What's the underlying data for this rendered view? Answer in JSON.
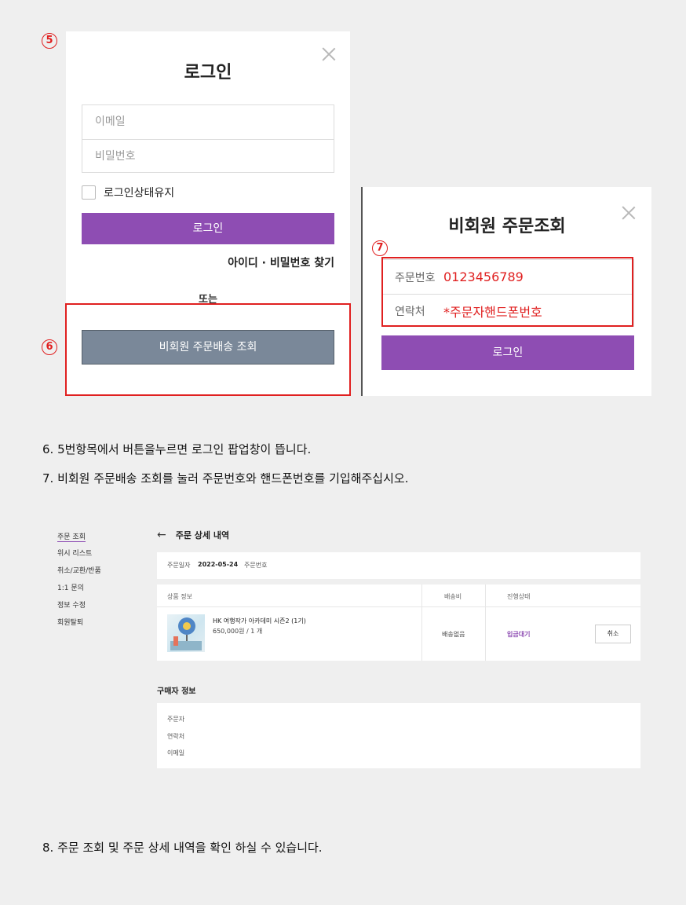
{
  "markers": {
    "five": "5",
    "six": "6",
    "seven": "7"
  },
  "login_popup": {
    "title": "로그인",
    "email_placeholder": "이메일",
    "password_placeholder": "비밀번호",
    "keep_login": "로그인상태유지",
    "login_button": "로그인",
    "find_link": "아이디 · 비밀번호 찾기",
    "or": "또는",
    "guest_button": "비회원 주문배송 조회"
  },
  "guest_popup": {
    "title": "비회원 주문조회",
    "order_no_label": "주문번호",
    "order_no_value": "0123456789",
    "contact_label": "연락처",
    "contact_value": "*주문자핸드폰번호",
    "login_button": "로그인"
  },
  "instructions": [
    "6. 5번항목에서 버튼을누르면  로그인 팝업창이 뜹니다.",
    "7. 비회원 주문배송 조회를 눌러 주문번호와 핸드폰번호를 기입해주십시오.",
    "8. 주문 조회 및 주문 상세 내역을 확인 하실 수 있습니다."
  ],
  "side_menu": [
    "주문 조회",
    "위시 리스트",
    "취소/교환/반품",
    "1:1 문의",
    "정보 수정",
    "회원탈퇴"
  ],
  "order_detail": {
    "back_icon": "arrow-left-icon",
    "title": "주문 상세 내역",
    "order_date_label": "주문일자",
    "order_date": "2022-05-24",
    "order_no_label": "주문번호",
    "columns": [
      "상품 정보",
      "배송비",
      "진행상태"
    ],
    "product": {
      "name": "HK 여행작가 아카데미 시즌2 (1기)",
      "price_qty": "650,000원 / 1 개",
      "shipping": "배송없음",
      "status": "입금대기",
      "cancel": "취소"
    },
    "buyer_title": "구매자 정보",
    "buyer_fields": [
      "주문자",
      "연락처",
      "이메일"
    ]
  },
  "colors": {
    "accent": "#8e4db3",
    "guest_button": "#7a8899",
    "highlight_red": "#e02020"
  }
}
